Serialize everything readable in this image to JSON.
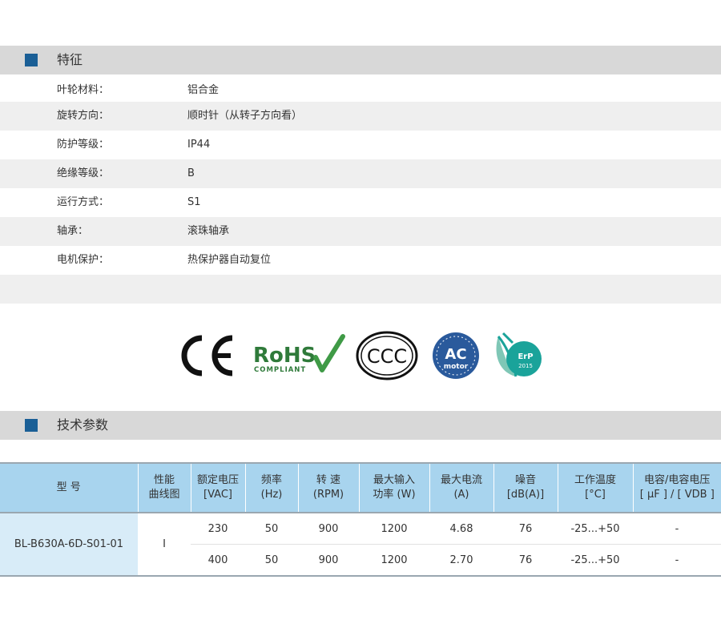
{
  "features": {
    "title": "特征",
    "rows": [
      {
        "label": "叶轮材料：",
        "value": "铝合金"
      },
      {
        "label": "旋转方向：",
        "value": "顺时针（从转子方向看）"
      },
      {
        "label": "防护等级：",
        "value": "IP44"
      },
      {
        "label": "绝缘等级：",
        "value": "B"
      },
      {
        "label": "运行方式：",
        "value": "S1"
      },
      {
        "label": "轴承：",
        "value": "滚珠轴承"
      },
      {
        "label": "电机保护：",
        "value": "热保护器自动复位"
      }
    ]
  },
  "certifications": {
    "ce": "CE",
    "rohs": "RoHS",
    "rohs_sub": "COMPLIANT",
    "ccc": "CCC",
    "ac_main": "AC",
    "ac_sub": "motor",
    "erp_main": "ErP",
    "erp_year": "2015"
  },
  "tech": {
    "title": "技术参数",
    "headers": [
      "型 号",
      "性能\n曲线图",
      "额定电压\n[VAC]",
      "频率\n(Hz)",
      "转 速\n(RPM)",
      "最大输入\n功率 (W)",
      "最大电流\n(A)",
      "噪音\n[dB(A)]",
      "工作温度\n[°C]",
      "电容/电容电压\n[ μF ] / [ VDB ]"
    ],
    "model": "BL-B630A-6D-S01-01",
    "curve": "I",
    "rows": [
      [
        "230",
        "50",
        "900",
        "1200",
        "4.68",
        "76",
        "-25...+50",
        "-"
      ],
      [
        "400",
        "50",
        "900",
        "1200",
        "2.70",
        "76",
        "-25...+50",
        "-"
      ]
    ]
  },
  "colors": {
    "accent_square": "#1a5f96",
    "section_bar": "#d8d8d8",
    "table_header": "#a8d4ee",
    "model_cell": "#d8ecf8",
    "rohs_green": "#2f7a3a",
    "ac_blue": "#2a5a9c",
    "erp_teal": "#1aa39a"
  }
}
